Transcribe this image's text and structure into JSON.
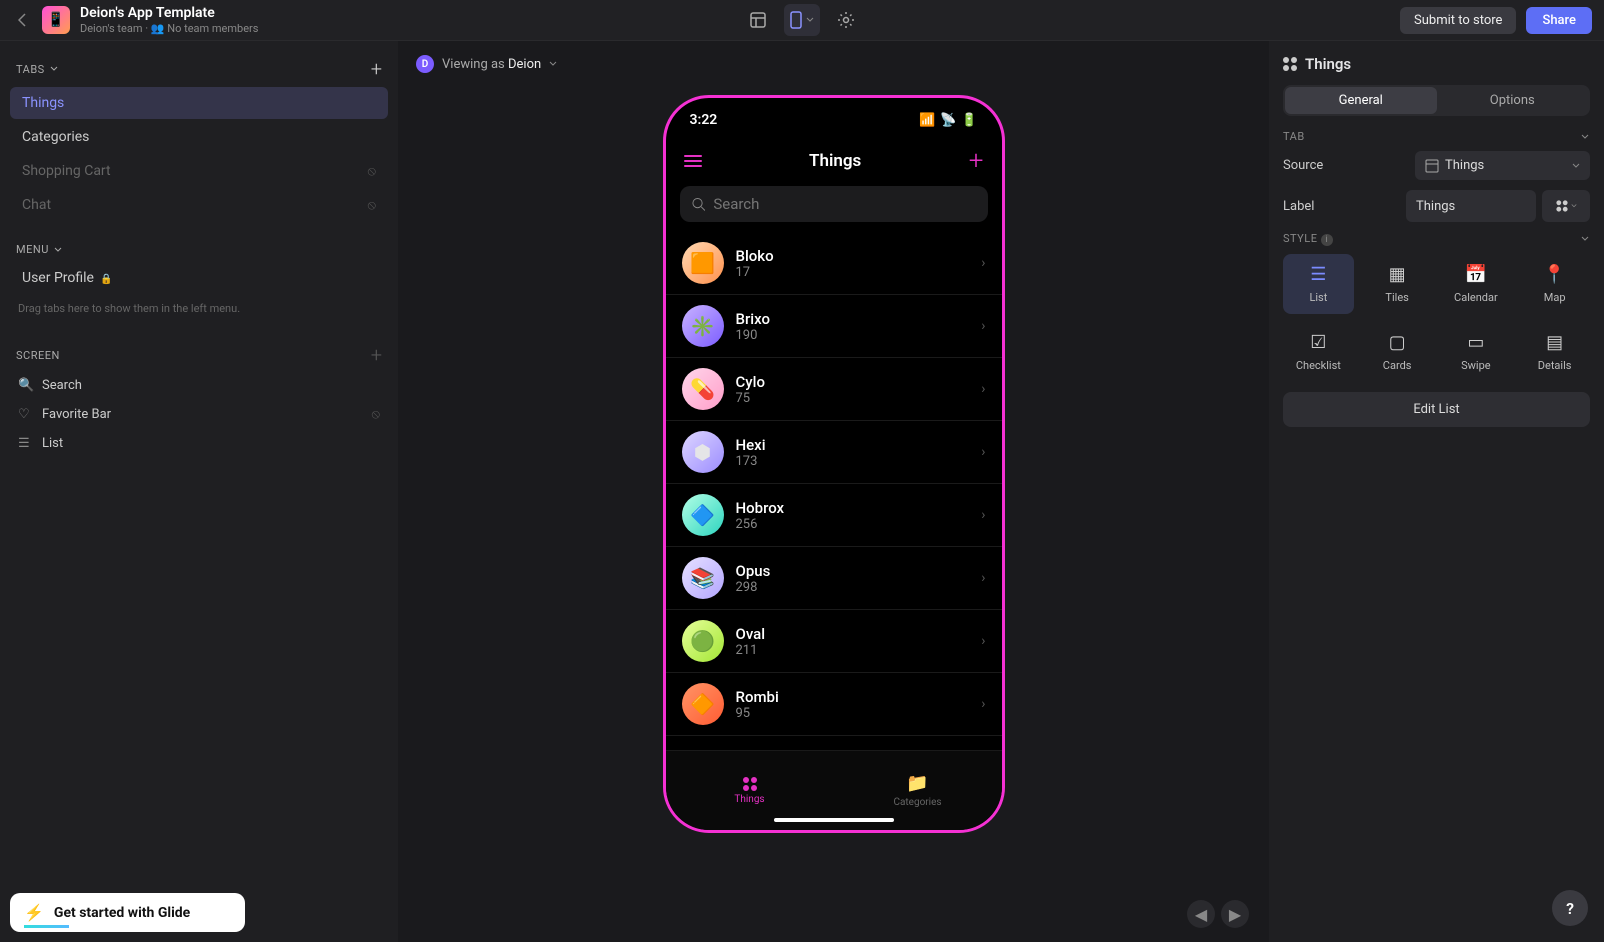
{
  "app": {
    "title": "Deion's App Template",
    "team": "Deion's team",
    "members": "No team members"
  },
  "topbar": {
    "submit": "Submit to store",
    "share": "Share"
  },
  "viewing": {
    "prefix": "Viewing as ",
    "user": "Deion",
    "initial": "D"
  },
  "left": {
    "tabs_label": "TABS",
    "menu_label": "MENU",
    "screen_label": "SCREEN",
    "tabs": [
      {
        "label": "Things",
        "active": true,
        "hidden": false
      },
      {
        "label": "Categories",
        "active": false,
        "hidden": false
      },
      {
        "label": "Shopping Cart",
        "active": false,
        "hidden": true
      },
      {
        "label": "Chat",
        "active": false,
        "hidden": true
      }
    ],
    "menu_items": [
      {
        "label": "User Profile",
        "locked": true
      }
    ],
    "menu_hint": "Drag tabs here to show them in the left menu.",
    "screen_items": [
      {
        "icon": "search",
        "label": "Search",
        "hidden": false
      },
      {
        "icon": "heart",
        "label": "Favorite Bar",
        "hidden": true
      },
      {
        "icon": "list",
        "label": "List",
        "hidden": false
      }
    ]
  },
  "phone": {
    "time": "3:22",
    "title": "Things",
    "search_placeholder": "Search",
    "items": [
      {
        "name": "Bloko",
        "count": "17",
        "bg": "linear-gradient(135deg,#ffd9b3,#ff914d)",
        "emoji": "🟧"
      },
      {
        "name": "Brixo",
        "count": "190",
        "bg": "linear-gradient(135deg,#c9b3ff,#7b5cff)",
        "emoji": "✳️"
      },
      {
        "name": "Cylo",
        "count": "75",
        "bg": "linear-gradient(135deg,#ffd6eb,#ff9ec9)",
        "emoji": "💊"
      },
      {
        "name": "Hexi",
        "count": "173",
        "bg": "linear-gradient(135deg,#ded6ff,#9b8cff)",
        "emoji": "⬢"
      },
      {
        "name": "Hobrox",
        "count": "256",
        "bg": "linear-gradient(135deg,#b3ffe6,#2dd4bf)",
        "emoji": "🔷"
      },
      {
        "name": "Opus",
        "count": "298",
        "bg": "linear-gradient(135deg,#e6e0ff,#b3a6ff)",
        "emoji": "📚"
      },
      {
        "name": "Oval",
        "count": "211",
        "bg": "linear-gradient(135deg,#e6ff99,#a3e635)",
        "emoji": "🟢"
      },
      {
        "name": "Rombi",
        "count": "95",
        "bg": "linear-gradient(135deg,#ff9466,#ff5c33)",
        "emoji": "🔶"
      }
    ],
    "tabs": [
      {
        "label": "Things",
        "active": true
      },
      {
        "label": "Categories",
        "active": false
      }
    ]
  },
  "right": {
    "title": "Things",
    "segments": {
      "general": "General",
      "options": "Options"
    },
    "tab_section": "TAB",
    "source_label": "Source",
    "source_value": "Things",
    "label_label": "Label",
    "label_value": "Things",
    "style_section": "STYLE",
    "styles": [
      {
        "label": "List",
        "icon": "☰",
        "active": true
      },
      {
        "label": "Tiles",
        "icon": "▦",
        "active": false
      },
      {
        "label": "Calendar",
        "icon": "📅",
        "active": false
      },
      {
        "label": "Map",
        "icon": "📍",
        "active": false
      },
      {
        "label": "Checklist",
        "icon": "☑",
        "active": false
      },
      {
        "label": "Cards",
        "icon": "▢",
        "active": false
      },
      {
        "label": "Swipe",
        "icon": "▭",
        "active": false
      },
      {
        "label": "Details",
        "icon": "▤",
        "active": false
      }
    ],
    "edit_list": "Edit List"
  },
  "get_started": "Get started with Glide",
  "help": "?"
}
